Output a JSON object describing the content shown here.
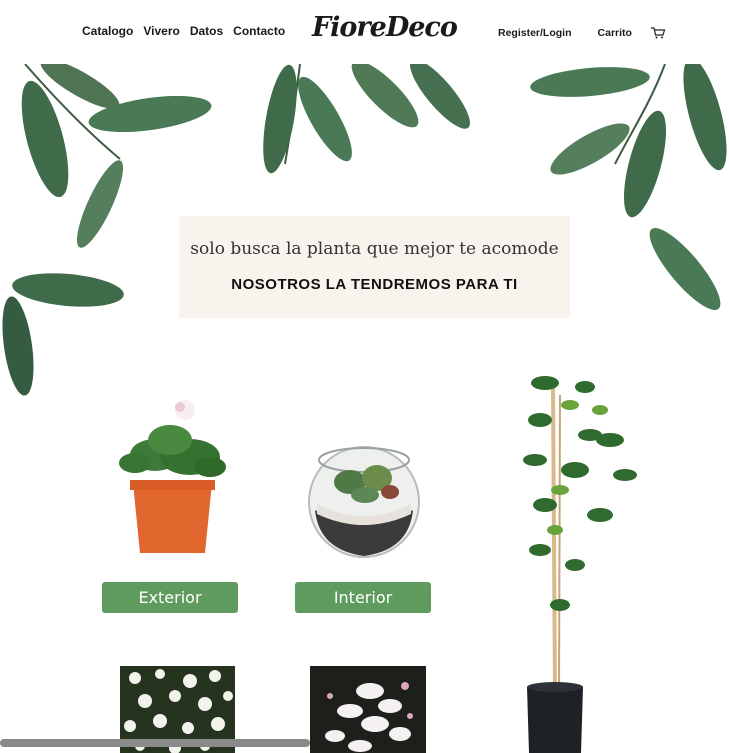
{
  "header": {
    "nav": [
      "Catalogo",
      "Vivero",
      "Datos",
      "Contacto"
    ],
    "brand": "FioreDeco",
    "register_login": "Register/Login",
    "cart": "Carrito",
    "cart_icon": "cart-icon"
  },
  "hero": {
    "line1": "solo busca la planta que mejor te acomode",
    "line2": "NOSOTROS LA TENDREMOS PARA TI"
  },
  "categories": {
    "exterior": "Exterior",
    "interior": "Interior"
  },
  "colors": {
    "button_green": "#5f9b5f",
    "tagline_bg": "#f8f4ed",
    "leaf_green": "#3f6b4a"
  }
}
